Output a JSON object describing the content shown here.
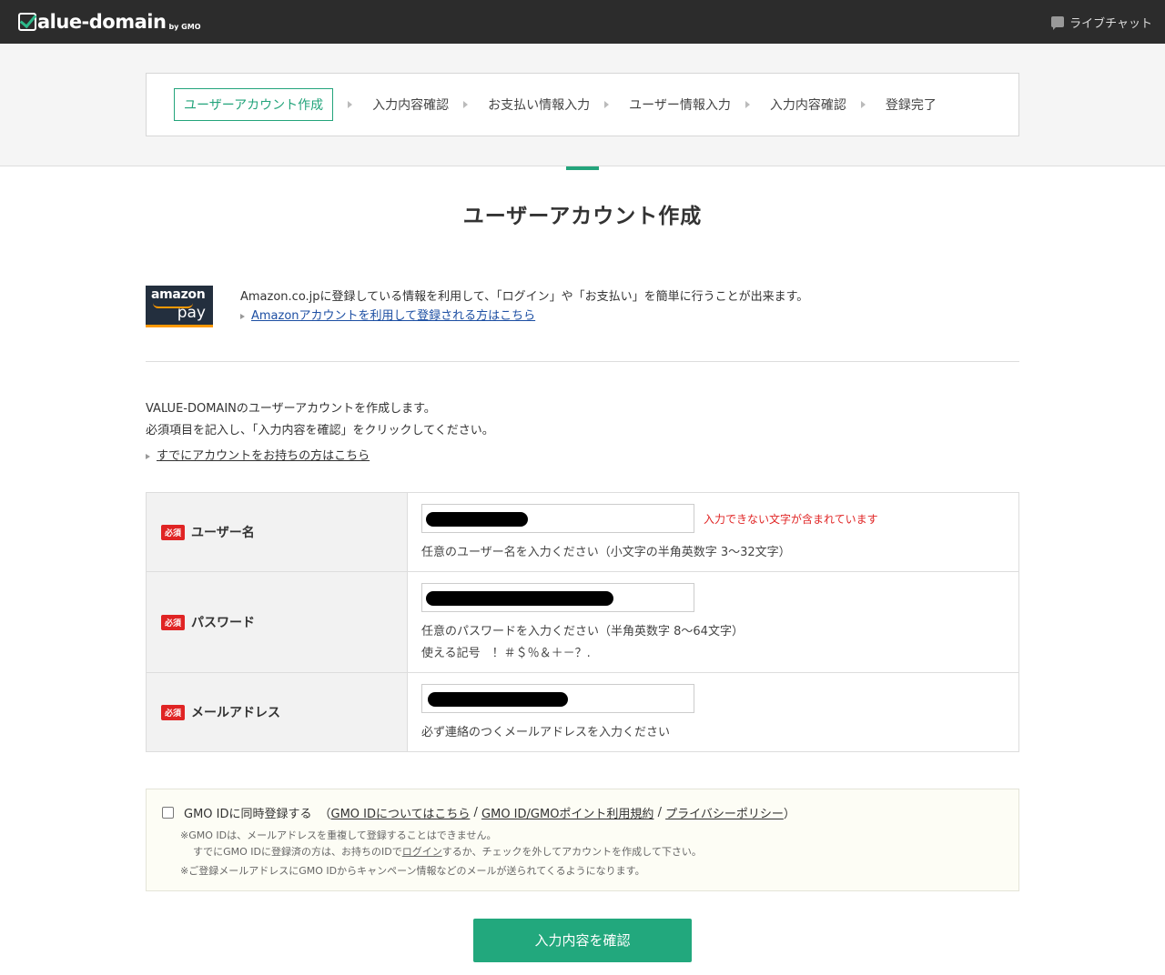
{
  "header": {
    "logo_text": "alue-domain",
    "logo_sub": "by GMO",
    "chat_label": "ライブチャット"
  },
  "steps": [
    {
      "label": "ユーザーアカウント作成",
      "active": true
    },
    {
      "label": "入力内容確認"
    },
    {
      "label": "お支払い情報入力"
    },
    {
      "label": "ユーザー情報入力"
    },
    {
      "label": "入力内容確認"
    },
    {
      "label": "登録完了"
    }
  ],
  "page": {
    "title": "ユーザーアカウント作成"
  },
  "amazon": {
    "logo_top": "amazon",
    "logo_bottom": "pay",
    "description": "Amazon.co.jpに登録している情報を利用して、「ログイン」や「お支払い」を簡単に行うことが出来ます。",
    "link": "Amazonアカウントを利用して登録される方はこちら"
  },
  "intro": {
    "line1": "VALUE-DOMAINのユーザーアカウントを作成します。",
    "line2": "必須項目を記入し、「入力内容を確認」をクリックしてください。",
    "link": "すでにアカウントをお持ちの方はこちら"
  },
  "form": {
    "required_badge": "必須",
    "username": {
      "label": "ユーザー名",
      "error": "入力できない文字が含まれています",
      "hint": "任意のユーザー名を入力ください（小文字の半角英数字 3〜32文字）"
    },
    "password": {
      "label": "パスワード",
      "hint": "任意のパスワードを入力ください（半角英数字 8〜64文字）",
      "hint2": "使える記号　！＃＄％＆＋－？."
    },
    "email": {
      "label": "メールアドレス",
      "hint": "必ず連絡のつくメールアドレスを入力ください"
    }
  },
  "gmo": {
    "checkbox_label": "GMO IDに同時登録する",
    "open_paren": "（",
    "link1": "GMO IDについてはこちら",
    "sep": " / ",
    "link2": "GMO ID/GMOポイント利用規約",
    "link3": "プライバシーポリシー",
    "close_paren": "）",
    "note1": "※GMO IDは、メールアドレスを重複して登録することはできません。",
    "note2a": "すでにGMO IDに登録済の方は、お持ちのIDで",
    "note2_link": "ログイン",
    "note2b": "するか、チェックを外してアカウントを作成して下さい。",
    "note3": "※ご登録メールアドレスにGMO IDからキャンペーン情報などのメールが送られてくるようになります。"
  },
  "submit_label": "入力内容を確認"
}
